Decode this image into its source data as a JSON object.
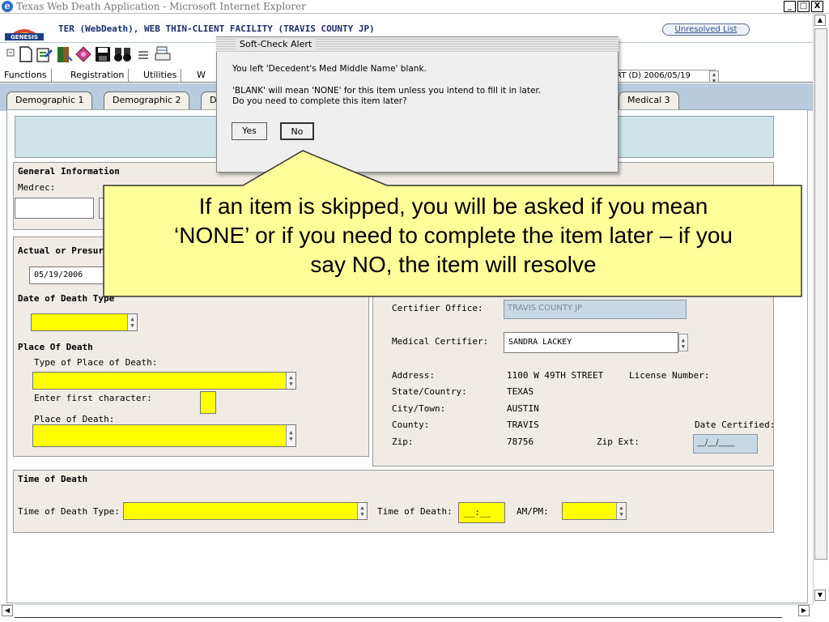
{
  "window": {
    "title": "Texas Web Death Application - Microsoft Internet Explorer",
    "minimize": "_",
    "maximize": "□",
    "close": "X",
    "ie_glyph": "e"
  },
  "app": {
    "logo_text": "GENESIS",
    "title": "TER (WebDeath), WEB THIN-CLIENT FACILITY (TRAVIS COUNTY JP)",
    "unresolved_label": "Unresolved List",
    "case_status": "RT (D) 2006/05/19"
  },
  "menu": [
    "Functions",
    "Registration",
    "Utilities",
    "W"
  ],
  "tabs": [
    "Demographic 1",
    "Demographic 2",
    "D",
    "Medical 3"
  ],
  "general_info": {
    "heading": "General Information",
    "medrec_label": "Medrec:"
  },
  "actual_presumed": {
    "heading": "Actual or Presur",
    "date_value": "05/19/2006",
    "date_type_heading": "Date of Death Type"
  },
  "place_of_death": {
    "heading": "Place Of Death",
    "type_label": "Type of Place of Death:",
    "first_char_label": "Enter first character:",
    "place_label": "Place of Death:"
  },
  "certifier": {
    "office_label": "Certifier Office:",
    "office_value": "TRAVIS COUNTY JP",
    "medical_label": "Medical Certifier:",
    "medical_value": "SANDRA  LACKEY",
    "address_label": "Address:",
    "address_value": "1100 W 49TH STREET",
    "license_label": "License Number:",
    "state_label": "State/Country:",
    "state_value": "TEXAS",
    "city_label": "City/Town:",
    "city_value": "AUSTIN",
    "county_label": "County:",
    "county_value": "TRAVIS",
    "date_certified_label": "Date Certified:",
    "zip_label": "Zip:",
    "zip_value": "78756",
    "zip_ext_label": "Zip Ext:",
    "date_certified_placeholder": "__/__/____"
  },
  "time_of_death": {
    "heading": "Time of Death",
    "type_label": "Time of Death Type:",
    "time_label": "Time of Death:",
    "time_placeholder": "__:__",
    "ampm_label": "AM/PM:"
  },
  "alert": {
    "title": "Soft-Check Alert",
    "line1": "You left 'Decedent's Med Middle Name' blank.",
    "line2": "'BLANK' will mean 'NONE' for this item unless you intend to fill it in later.",
    "line3": "Do you need to complete this item later?",
    "yes": "Yes",
    "no": "No"
  },
  "callout": {
    "line1": "If an item is skipped, you will be asked if you mean",
    "line2": "‘NONE’ or if you need to complete the item later – if you",
    "line3": "say NO, the item will resolve"
  },
  "colors": {
    "required_field": "#ffff00",
    "panel": "#f0ebe5",
    "tab_strip": "#b9cbdc",
    "callout_fill": "#ffff99"
  },
  "icons": [
    "new-document-icon",
    "edit-icon",
    "exit-door-icon",
    "diamond-icon",
    "save-icon",
    "search-binoculars-icon",
    "list-icon",
    "printer-icon"
  ]
}
